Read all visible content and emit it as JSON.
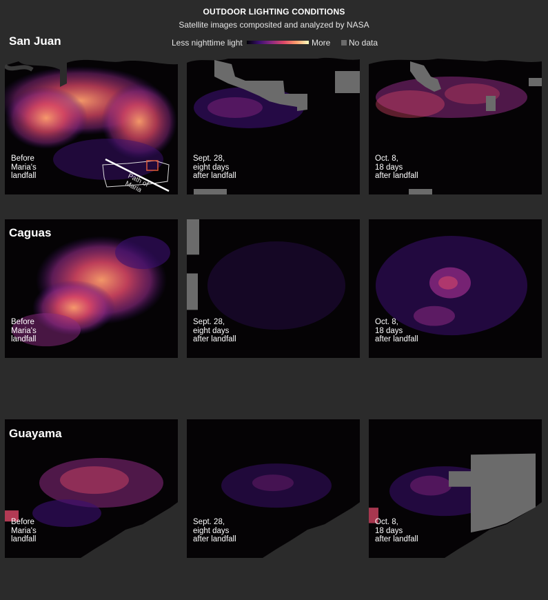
{
  "header": {
    "title": "OUTDOOR LIGHTING CONDITIONS",
    "subtitle": "Satellite images composited and analyzed by NASA"
  },
  "legend": {
    "less_label": "Less nighttime light",
    "more_label": "More",
    "no_data_label": "No data",
    "colors": {
      "ramp": [
        "#000004",
        "#3b0f70",
        "#8c2981",
        "#de4968",
        "#fe9f6d",
        "#fcfdbf"
      ],
      "no_data": "#6b6b6b"
    }
  },
  "inset": {
    "path_label_1": "Path of",
    "path_label_2": "Maria"
  },
  "rows": [
    {
      "city": "San Juan",
      "panels": [
        {
          "lines": [
            "Before",
            "Maria's",
            "landfall"
          ],
          "brightness": "high"
        },
        {
          "lines": [
            "Sept. 28,",
            "eight days",
            "after landfall"
          ],
          "brightness": "low"
        },
        {
          "lines": [
            "Oct. 8,",
            "18 days",
            "after landfall"
          ],
          "brightness": "medium"
        }
      ]
    },
    {
      "city": "Caguas",
      "panels": [
        {
          "lines": [
            "Before",
            "Maria's",
            "landfall"
          ],
          "brightness": "high"
        },
        {
          "lines": [
            "Sept. 28,",
            "eight days",
            "after landfall"
          ],
          "brightness": "very-low"
        },
        {
          "lines": [
            "Oct. 8,",
            "18 days",
            "after landfall"
          ],
          "brightness": "medium"
        }
      ]
    },
    {
      "city": "Guayama",
      "panels": [
        {
          "lines": [
            "Before",
            "Maria's",
            "landfall"
          ],
          "brightness": "high"
        },
        {
          "lines": [
            "Sept. 28,",
            "eight days",
            "after landfall"
          ],
          "brightness": "low"
        },
        {
          "lines": [
            "Oct. 8,",
            "18 days",
            "after landfall"
          ],
          "brightness": "low"
        }
      ]
    }
  ]
}
